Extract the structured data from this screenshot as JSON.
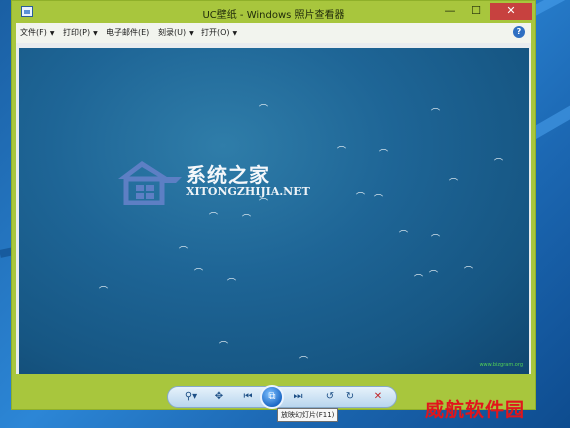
{
  "window": {
    "title": "UC壁纸 - Windows 照片查看器",
    "min_glyph": "—",
    "max_glyph": "☐",
    "close_glyph": "✕"
  },
  "menu": {
    "items": [
      {
        "label": "文件(F)"
      },
      {
        "label": "打印(P)"
      },
      {
        "label": "电子邮件(E)"
      },
      {
        "label": "刻录(U)"
      },
      {
        "label": "打开(O)"
      }
    ],
    "dropdown_glyph": "▼",
    "help_glyph": "?"
  },
  "photo": {
    "logo_cn": "系统之家",
    "logo_en": "XITONGZHIJIA.NET",
    "small_watermark": "www.bizgram.org"
  },
  "toolbar": {
    "zoom_glyph": "⚲▾",
    "fit_glyph": "✥",
    "prev_glyph": "⏮",
    "play_glyph": "⧉",
    "next_glyph": "⏭",
    "rotate_left_glyph": "↺",
    "rotate_right_glyph": "↻",
    "delete_glyph": "✕",
    "tooltip": "放映幻灯片(F11)"
  },
  "site_watermark": "威航软件园",
  "colors": {
    "window_frame": "#a8c63d",
    "close_button": "#c7413f",
    "photo_sea": "#1e6596",
    "watermark_red": "#e0161c"
  },
  "icons": {
    "app": "photo-viewer-icon",
    "help": "help-icon",
    "zoom": "zoom-icon",
    "fit": "actual-size-icon",
    "prev": "previous-icon",
    "play": "slideshow-icon",
    "next": "next-icon",
    "rotate_left": "rotate-counterclockwise-icon",
    "rotate_right": "rotate-clockwise-icon",
    "delete": "delete-icon"
  }
}
